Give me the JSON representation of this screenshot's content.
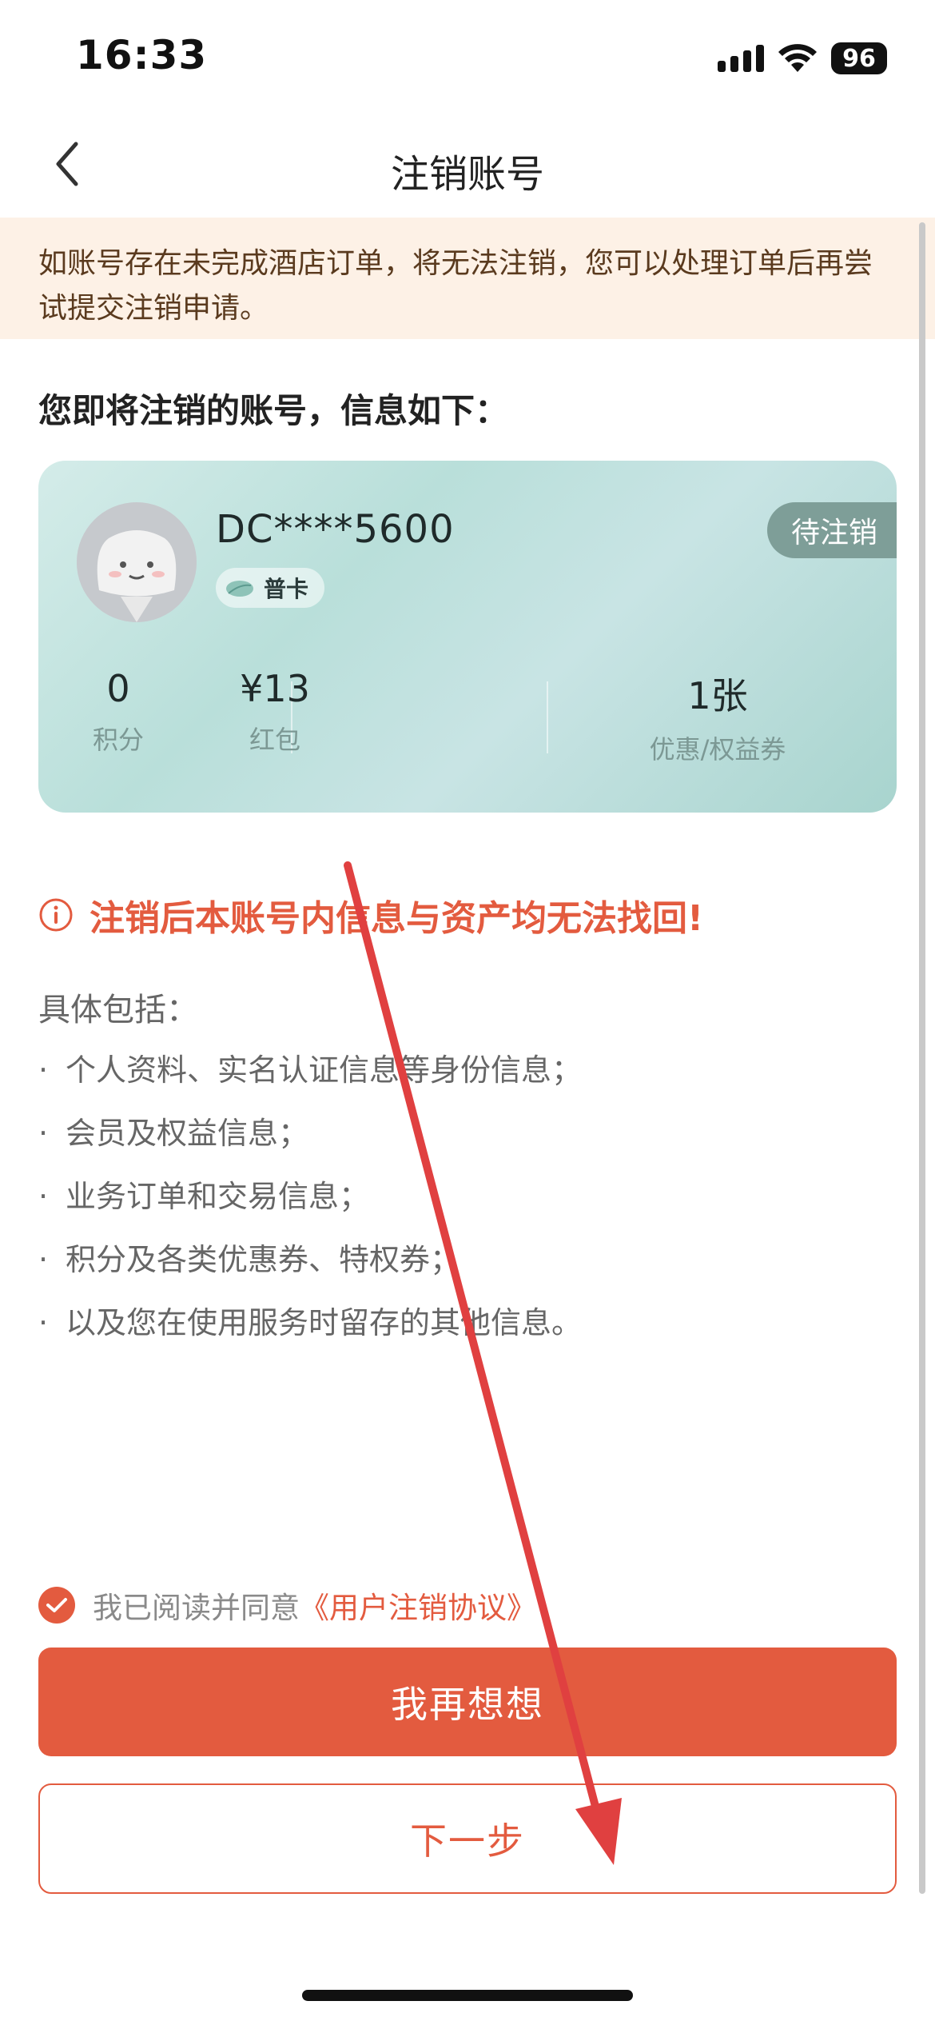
{
  "status_bar": {
    "time": "16:33",
    "battery": "96",
    "icons": [
      "signal-icon",
      "wifi-icon",
      "battery-icon"
    ]
  },
  "nav": {
    "back_icon": "chevron-left-icon",
    "title": "注销账号"
  },
  "notice": {
    "text": "如账号存在未完成酒店订单，将无法注销，您可以处理订单后再尝试提交注销申请。"
  },
  "section_title": "您即将注销的账号，信息如下：",
  "account_card": {
    "name": "DC****5600",
    "tier": "普卡",
    "status": "待注销",
    "stats": [
      {
        "value": "0",
        "label": "积分"
      },
      {
        "value": "¥13",
        "label": "红包"
      },
      {
        "value": "1张",
        "label": "优惠/权益券"
      }
    ]
  },
  "warning": {
    "icon": "info-circle-icon",
    "text": "注销后本账号内信息与资产均无法找回!"
  },
  "details": {
    "title": "具体包括：",
    "items": [
      "个人资料、实名认证信息等身份信息；",
      "会员及权益信息；",
      "业务订单和交易信息；",
      "积分及各类优惠券、特权券；",
      "以及您在使用服务时留存的其他信息。"
    ]
  },
  "agreement": {
    "checked": true,
    "prefix": "我已阅读并同意",
    "link": "《用户注销协议》"
  },
  "buttons": {
    "primary": "我再想想",
    "secondary": "下一步"
  },
  "colors": {
    "accent": "#e35b3f",
    "notice_bg": "#fdf1e6",
    "card_teal": "#b9dfda",
    "annotation_arrow": "#e04040"
  }
}
